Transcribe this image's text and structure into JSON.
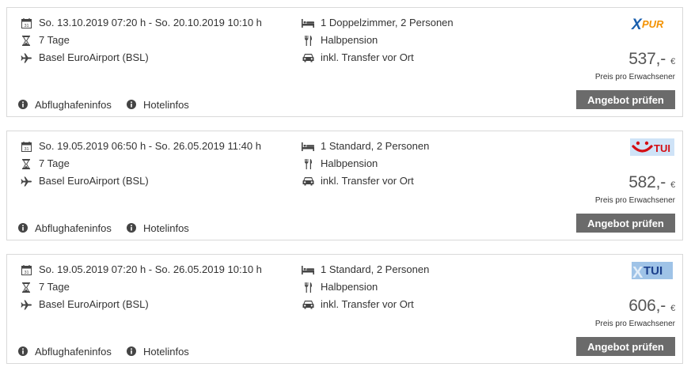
{
  "offers": [
    {
      "dates": "So. 13.10.2019 07:20 h - So. 20.10.2019 10:10 h",
      "duration": "7 Tage",
      "airport": "Basel EuroAirport (BSL)",
      "room": "1 Doppelzimmer, 2 Personen",
      "board": "Halbpension",
      "transfer": "inkl. Transfer vor Ort",
      "operator_logo": "XPUR",
      "price": "537,-",
      "currency": "€",
      "price_note": "Preis pro Erwachsener",
      "airport_link": "Abflughafeninfos",
      "hotel_link": "Hotelinfos",
      "button_label": "Angebot prüfen"
    },
    {
      "dates": "So. 19.05.2019 06:50 h - So. 26.05.2019 11:40 h",
      "duration": "7 Tage",
      "airport": "Basel EuroAirport (BSL)",
      "room": "1 Standard, 2 Personen",
      "board": "Halbpension",
      "transfer": "inkl. Transfer vor Ort",
      "operator_logo": "TUI",
      "price": "582,-",
      "currency": "€",
      "price_note": "Preis pro Erwachsener",
      "airport_link": "Abflughafeninfos",
      "hotel_link": "Hotelinfos",
      "button_label": "Angebot prüfen"
    },
    {
      "dates": "So. 19.05.2019 07:20 h - So. 26.05.2019 10:10 h",
      "duration": "7 Tage",
      "airport": "Basel EuroAirport (BSL)",
      "room": "1 Standard, 2 Personen",
      "board": "Halbpension",
      "transfer": "inkl. Transfer vor Ort",
      "operator_logo": "XTUI",
      "price": "606,-",
      "currency": "€",
      "price_note": "Preis pro Erwachsener",
      "airport_link": "Abflughafeninfos",
      "hotel_link": "Hotelinfos",
      "button_label": "Angebot prüfen"
    }
  ],
  "icons": {
    "date": "calendar-icon",
    "duration": "hourglass-icon",
    "airport": "airplane-icon",
    "room": "bed-icon",
    "board": "cutlery-icon",
    "transfer": "car-icon",
    "info": "info-icon"
  },
  "colors": {
    "button_bg": "#6b6b6b",
    "card_border": "#d9d9d9",
    "xpur_blue": "#1a5fae",
    "xpur_orange": "#f39200",
    "tui_red": "#d40e14",
    "tui_blue_bg": "#cfe3f7",
    "xtui_blue": "#1b3f8c",
    "xtui_bg": "#9fc3e7"
  }
}
